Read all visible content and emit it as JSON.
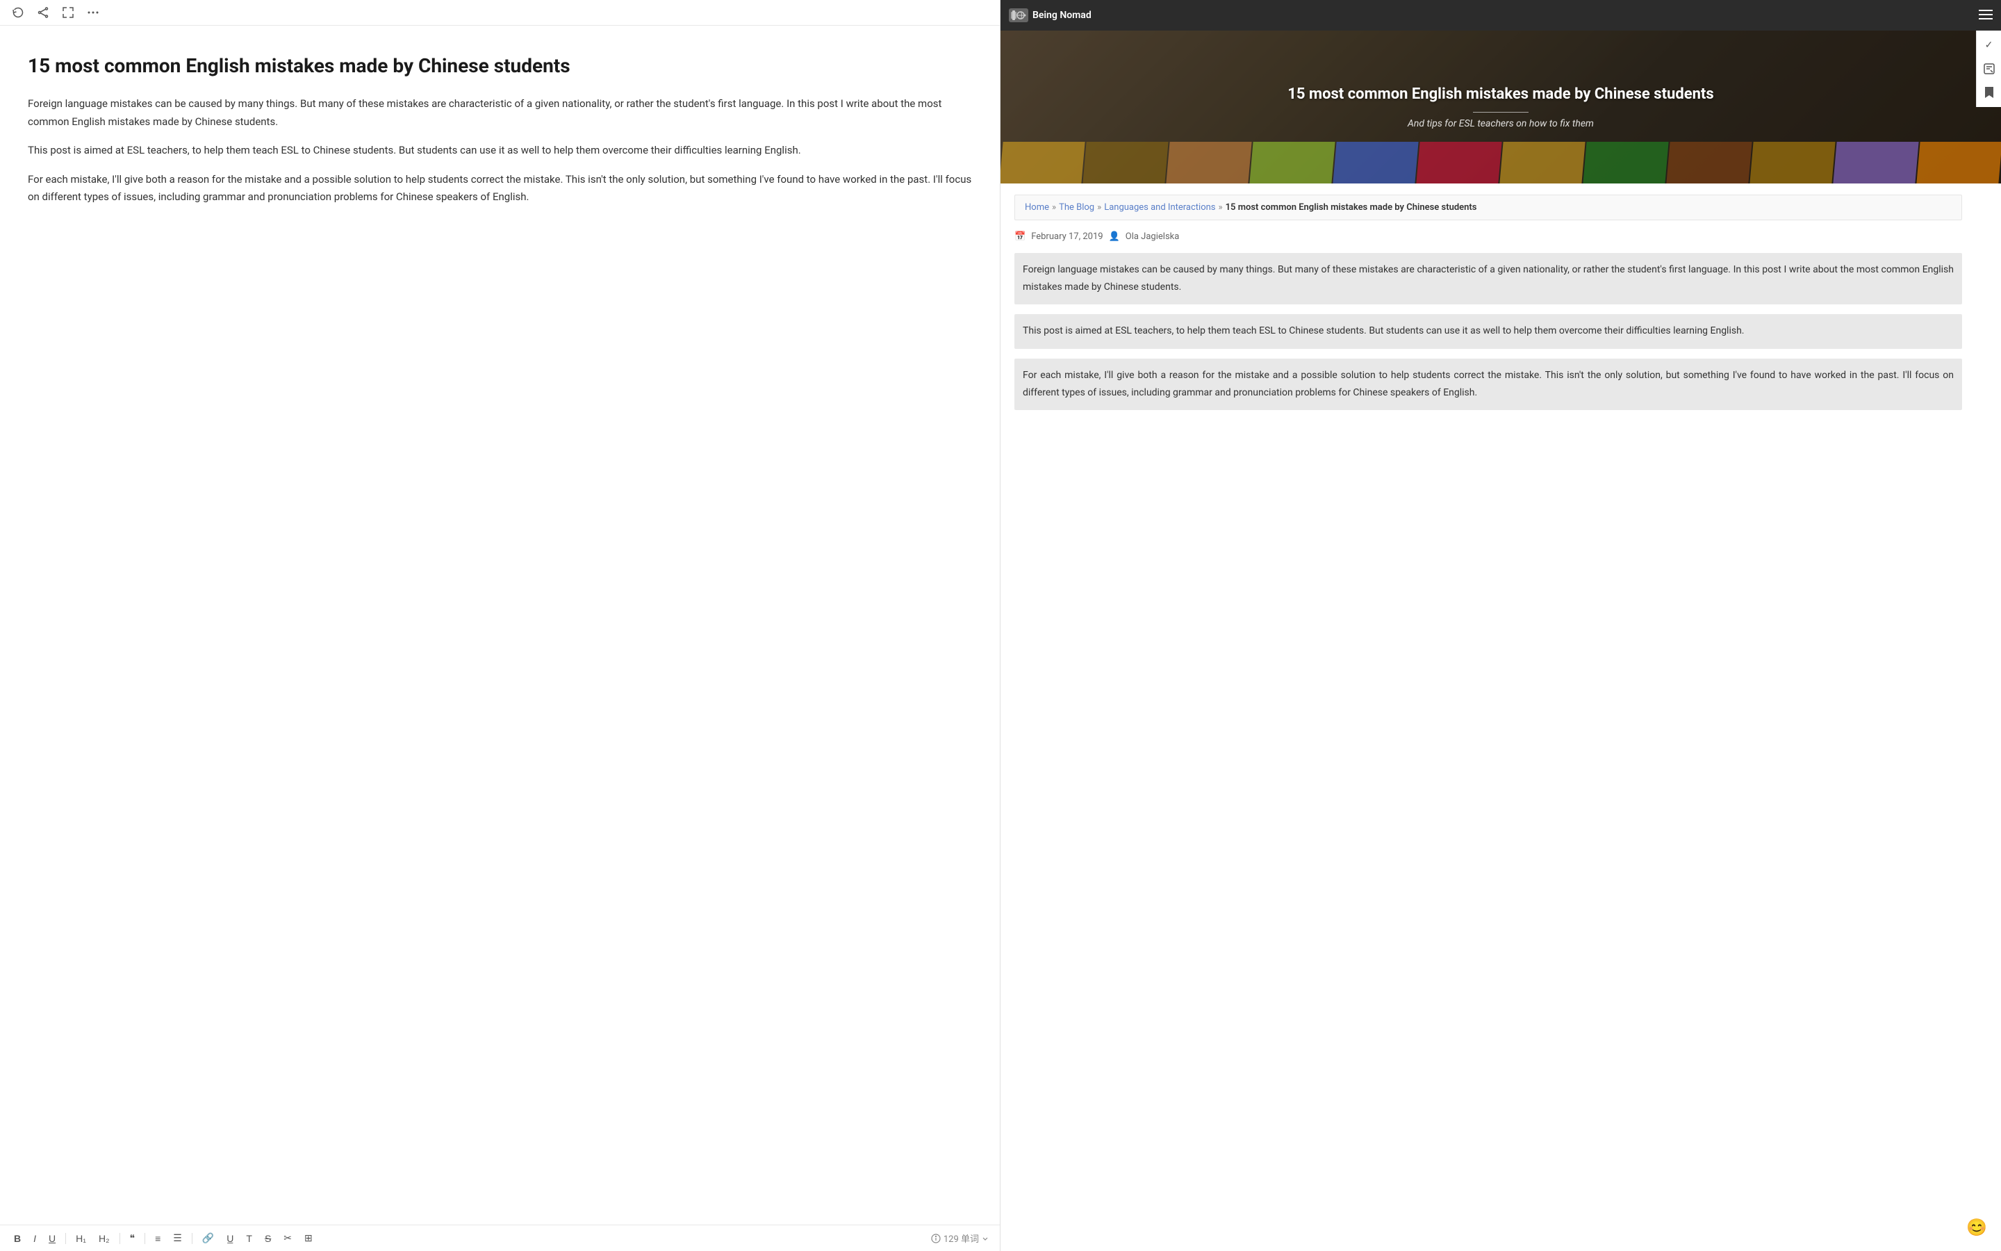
{
  "leftPanel": {
    "title": "15 most common English mistakes made by Chinese students",
    "paragraphs": [
      "Foreign language mistakes can be caused by many things. But many of these mistakes are characteristic of a given nationality, or rather the student's first language. In this post I write about the most common English mistakes made by Chinese students.",
      "This post is aimed at ESL teachers, to help them teach ESL to Chinese students. But students can use it as well to help them overcome their difficulties learning English.",
      "For each mistake, I'll give both a reason for the mistake and a possible solution to help students correct the mistake. This isn't the only solution, but something I've found to have worked in the past. I'll focus on different types of issues, including grammar and pronunciation problems for Chinese speakers of English."
    ],
    "toolbar": {
      "wordCount": "129 单词",
      "buttons": [
        "B",
        "I",
        "U",
        "H1",
        "H2",
        "\"\"",
        "OL",
        "UL",
        "Link",
        "U̲",
        "T",
        "S",
        "✂",
        "⊞"
      ]
    }
  },
  "rightPanel": {
    "nav": {
      "logoText": "Being Nomad",
      "logoSubtext": ""
    },
    "hero": {
      "title": "15 most common English mistakes made by Chinese students",
      "subtitle": "And tips for ESL teachers on how to fix them"
    },
    "breadcrumb": {
      "home": "Home",
      "blog": "The Blog",
      "category": "Languages and Interactions",
      "current": "15 most common English mistakes made by Chinese students"
    },
    "meta": {
      "date": "February 17, 2019",
      "author": "Ola Jagielska"
    },
    "paragraphs": [
      "Foreign language mistakes can be caused by many things. But many of these mistakes are characteristic of a given nationality, or rather the student's first language. In this post I write about the most common English mistakes made by Chinese students.",
      "This post is aimed at ESL teachers, to help them teach ESL to Chinese students. But students can use it as well to help them overcome their difficulties learning English.",
      "For each mistake, I'll give both a reason for the mistake and a possible solution to help students correct the mistake. This isn't the only solution, but something I've found to have worked in the past. I'll focus on different types of issues, including grammar and pronunciation problems for Chinese speakers of English."
    ],
    "sidebarIcons": [
      "✓",
      "◧",
      "▲"
    ],
    "emoji": "😊"
  }
}
